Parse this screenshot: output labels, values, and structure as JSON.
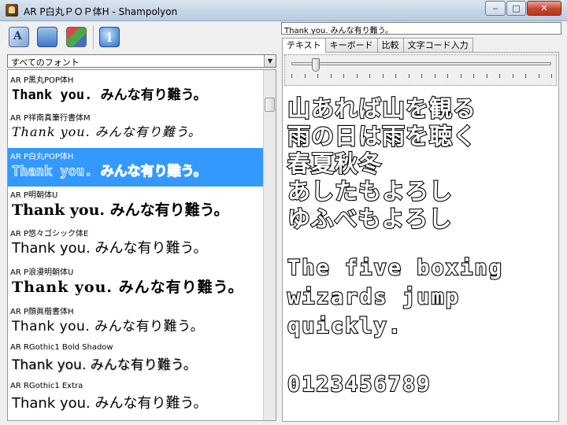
{
  "window": {
    "title": "AR P白丸ＰＯＰ体H - Shampolyon",
    "min_glyph": "‒",
    "max_glyph": "□",
    "close_glyph": "✕"
  },
  "toolbar": {
    "icons": [
      "font-settings-icon",
      "computer-icon",
      "chart-icon",
      "info-icon"
    ],
    "info_glyph": "i"
  },
  "font_filter": {
    "value": "すべてのフォント",
    "arrow": "▼"
  },
  "font_list": {
    "items": [
      {
        "name": "AR P黒丸POP体H",
        "sample": "Thank you. みんな有り難う。"
      },
      {
        "name": "AR P祥南真筆行書体M",
        "sample": "Thank you. みんな有り難う。"
      },
      {
        "name": "AR P白丸POP体H",
        "sample": "Thank you. みんな有り難う。",
        "selected": true
      },
      {
        "name": "AR P明朝体U",
        "sample": "Thank you. みんな有り難う。"
      },
      {
        "name": "AR P悠々ゴシック体E",
        "sample": "Thank you. みんな有り難う。"
      },
      {
        "name": "AR P浪漫明朝体U",
        "sample": "Thank you. みんな有り難う。"
      },
      {
        "name": "AR P顔眞楷書体H",
        "sample": "Thank you. みんな有り難う。"
      },
      {
        "name": "AR RGothic1 Bold Shadow",
        "sample": "Thank you. みんな有り難う。"
      },
      {
        "name": "AR RGothic1 Extra",
        "sample": "Thank you. みんな有り難う。"
      }
    ]
  },
  "sample_text": {
    "value": "Thank you. みんな有り難う。"
  },
  "tabs": [
    {
      "label": "テキスト",
      "active": true
    },
    {
      "label": "キーボード"
    },
    {
      "label": "比較"
    },
    {
      "label": "文字コード入力"
    }
  ],
  "size_slider": {
    "value_fraction": 0.09
  },
  "preview": {
    "lines": [
      "山あれば山を観る",
      "雨の日は雨を聴く",
      "春夏秋冬",
      "あしたもよろし",
      "ゆふべもよろし",
      "The five boxing",
      "wizards jump",
      "quickly.",
      "0123456789"
    ]
  },
  "colors": {
    "selection": "#3399ff",
    "titlebar": "#c6d5e6",
    "close_button": "#c7442c"
  }
}
